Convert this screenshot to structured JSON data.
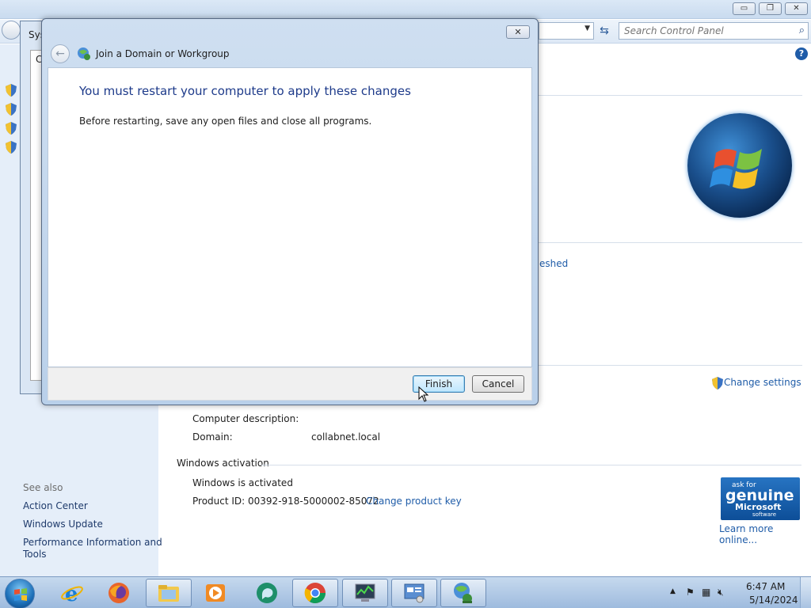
{
  "control_panel": {
    "search_placeholder": "Search Control Panel",
    "left_pane": {
      "see_also": "See also",
      "links": [
        "Action Center",
        "Windows Update",
        "Performance Information and",
        "Tools"
      ]
    },
    "partial_link_refreshed": "eshed",
    "change_settings": "Change settings",
    "computer_description_label": "Computer description:",
    "domain_label": "Domain:",
    "domain_value": "collabnet.local",
    "activation_heading": "Windows activation",
    "activation_status": "Windows is activated",
    "product_id": "Product ID: 00392-918-5000002-85072",
    "change_product_key": "Change product key",
    "genuine_badge": {
      "line1": "ask for",
      "line2": "genuine",
      "line3": "Microsoft",
      "line4": "software"
    },
    "learn_more": "Learn more online..."
  },
  "system_properties": {
    "title_fragment": "Sys",
    "tab_fragment": "C"
  },
  "dialog": {
    "title": "Join a Domain or Workgroup",
    "heading": "You must restart your computer to apply these changes",
    "message": "Before restarting, save any open files and close all programs.",
    "finish_label": "Finish",
    "cancel_label": "Cancel"
  },
  "taskbar": {
    "time": "6:47 AM",
    "date": "5/14/2024"
  },
  "colors": {
    "link": "#1f5ca8",
    "heading": "#1d3a8a",
    "taskbar": "#9ebbde"
  }
}
